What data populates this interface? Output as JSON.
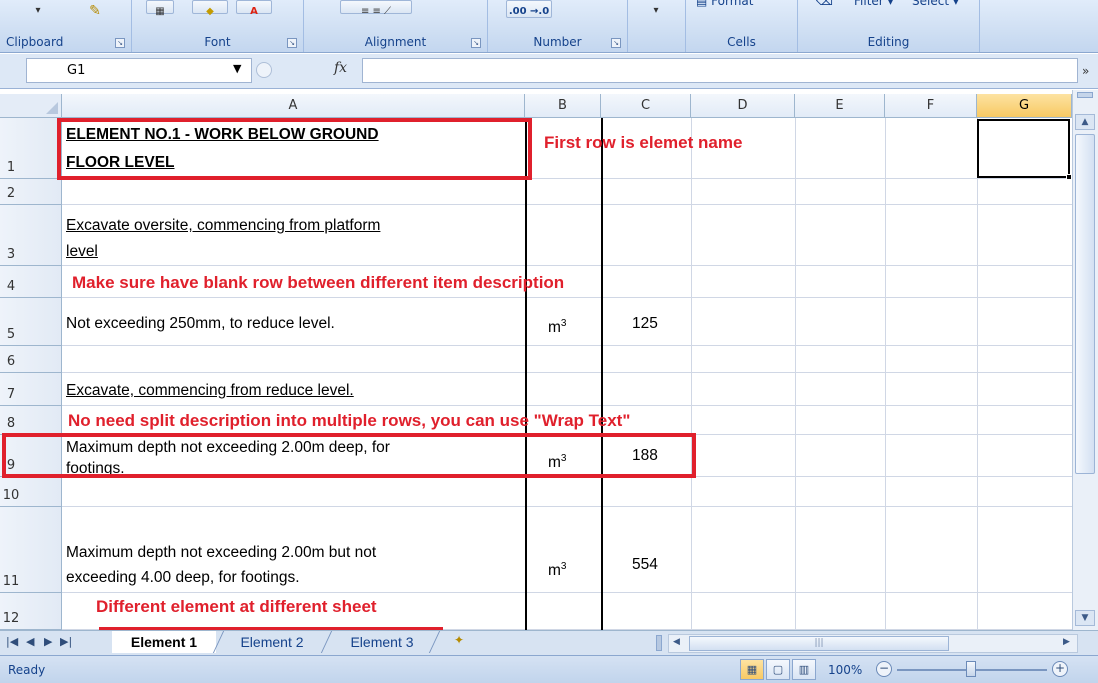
{
  "ribbon": {
    "groups": [
      {
        "label": "Clipboard"
      },
      {
        "label": "Font"
      },
      {
        "label": "Alignment"
      },
      {
        "label": "Number"
      },
      {
        "label": ""
      },
      {
        "label": "Cells"
      },
      {
        "label": "Editing"
      }
    ],
    "number_format_button": ".00 →.0",
    "format_label": "Format",
    "filter_label": "Filter ▾",
    "select_label": "Select ▾"
  },
  "formula_bar": {
    "name_box_value": "G1",
    "fx_label": "fx",
    "formula_value": ""
  },
  "columns": [
    "A",
    "B",
    "C",
    "D",
    "E",
    "F",
    "G"
  ],
  "selected_column": "G",
  "rows": [
    "1",
    "2",
    "3",
    "4",
    "5",
    "6",
    "7",
    "8",
    "9",
    "10",
    "11",
    "12"
  ],
  "cells": {
    "a1_line1": "ELEMENT NO.1 - WORK BELOW GROUND",
    "a1_line2": "FLOOR LEVEL",
    "a3_line1": "Excavate oversite, commencing from platform ",
    "a3_line2": "level",
    "a5": "Not exceeding 250mm, to reduce level.",
    "b5_unit": "m",
    "b5_sup": "3",
    "c5": "125",
    "a7": "Excavate, commencing from reduce level.",
    "a9_line1": "Maximum depth not exceeding 2.00m deep, for",
    "a9_line2": "footings.",
    "b9_unit": "m",
    "b9_sup": "3",
    "c9": "188",
    "a11_line1": "Maximum depth not exceeding 2.00m but not",
    "a11_line2": "exceeding 4.00 deep, for footings.",
    "b11_unit": "m",
    "b11_sup": "3",
    "c11": "554"
  },
  "annotations": {
    "first_row": "First row is elemet name",
    "blank_row": "Make sure have blank row between different item description",
    "wrap_text": "No need split description into multiple rows, you can use \"Wrap Text\"",
    "different_sheet": "Different element at different sheet"
  },
  "sheet_tabs": [
    "Element 1",
    "Element 2",
    "Element 3"
  ],
  "active_sheet": "Element 1",
  "status": {
    "ready": "Ready",
    "zoom": "100%"
  },
  "colors": {
    "annotation_red": "#e0202c",
    "ribbon_text": "#15428b",
    "selected_header": "#f8c963"
  }
}
